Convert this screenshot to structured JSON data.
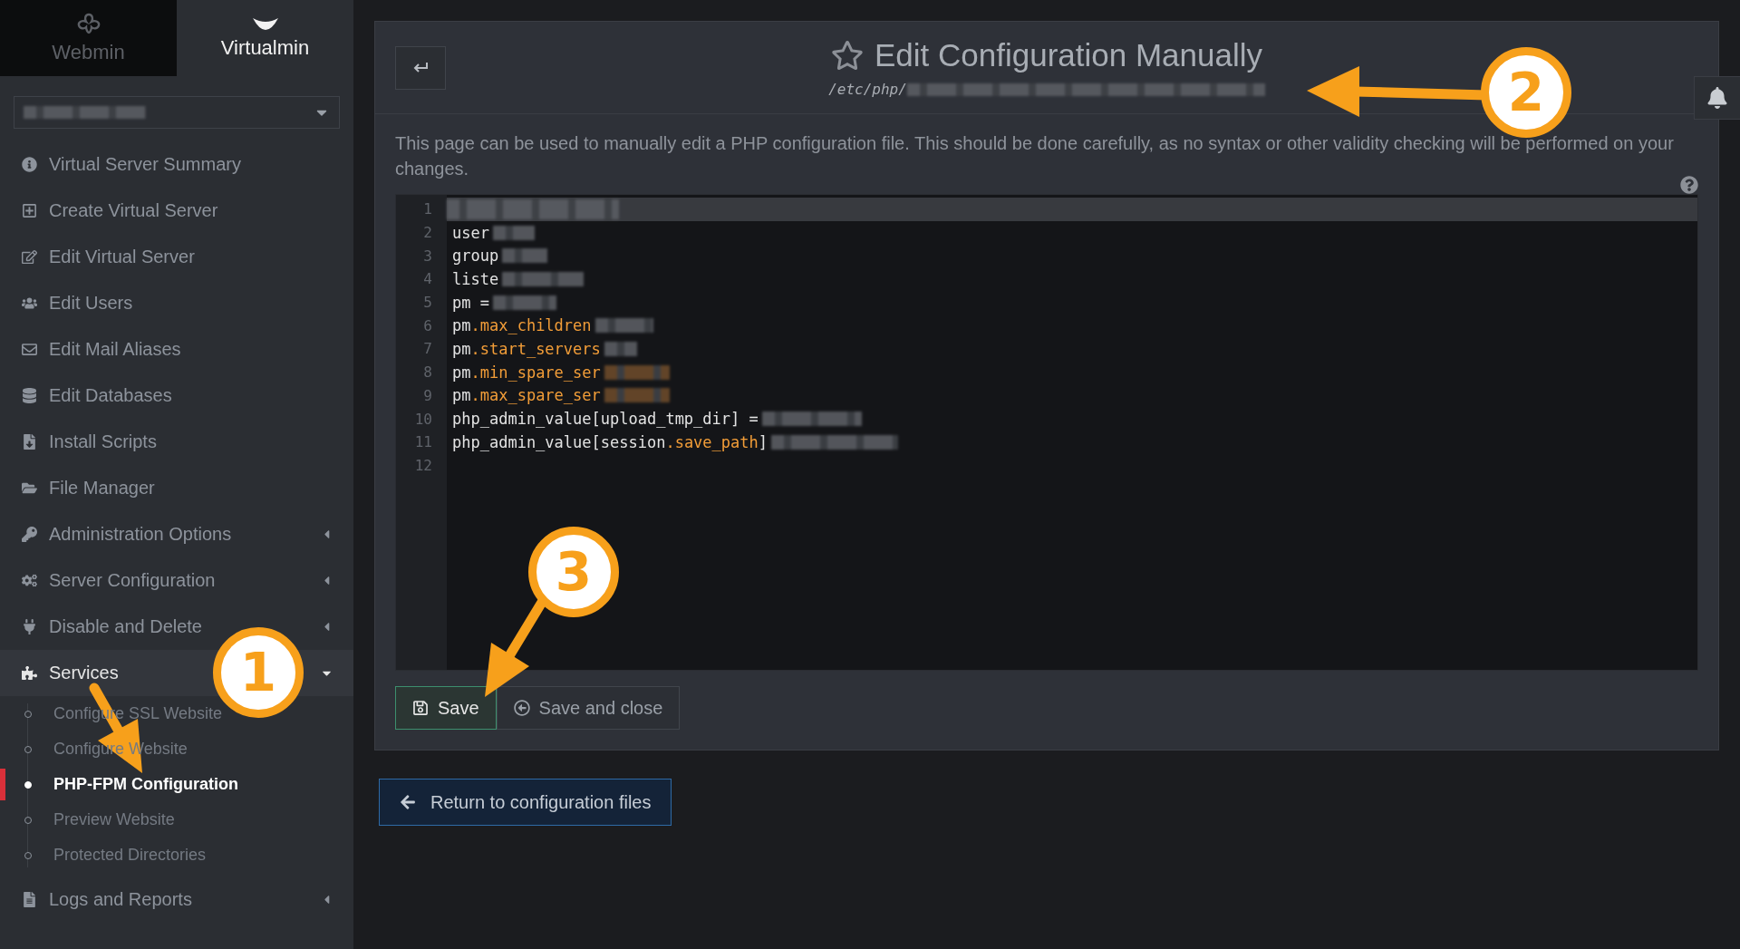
{
  "top_tabs": [
    {
      "label": "Webmin",
      "selected": false
    },
    {
      "label": "Virtualmin",
      "selected": true
    }
  ],
  "server_select": {
    "masked": true
  },
  "menu": [
    {
      "label": "Virtual Server Summary",
      "has_submenu": false,
      "expanded": false
    },
    {
      "label": "Create Virtual Server",
      "has_submenu": false,
      "expanded": false
    },
    {
      "label": "Edit Virtual Server",
      "has_submenu": false,
      "expanded": false
    },
    {
      "label": "Edit Users",
      "has_submenu": false,
      "expanded": false
    },
    {
      "label": "Edit Mail Aliases",
      "has_submenu": false,
      "expanded": false
    },
    {
      "label": "Edit Databases",
      "has_submenu": false,
      "expanded": false
    },
    {
      "label": "Install Scripts",
      "has_submenu": false,
      "expanded": false
    },
    {
      "label": "File Manager",
      "has_submenu": false,
      "expanded": false
    },
    {
      "label": "Administration Options",
      "has_submenu": true,
      "expanded": false
    },
    {
      "label": "Server Configuration",
      "has_submenu": true,
      "expanded": false
    },
    {
      "label": "Disable and Delete",
      "has_submenu": true,
      "expanded": false
    },
    {
      "label": "Services",
      "has_submenu": true,
      "expanded": true,
      "children": [
        {
          "label": "Configure SSL Website",
          "selected": false
        },
        {
          "label": "Configure Website",
          "selected": false
        },
        {
          "label": "PHP-FPM Configuration",
          "selected": true
        },
        {
          "label": "Preview Website",
          "selected": false
        },
        {
          "label": "Protected Directories",
          "selected": false
        }
      ]
    },
    {
      "label": "Logs and Reports",
      "has_submenu": true,
      "expanded": false
    }
  ],
  "page": {
    "title": "Edit Configuration Manually",
    "path": "/etc/php/",
    "path_masked": true,
    "description": "This page can be used to manually edit a PHP configuration file. This should be done carefully, as no syntax or other validity checking will be performed on your changes."
  },
  "editor": {
    "lines": [
      {
        "number": "1",
        "active": true,
        "masked": true
      },
      {
        "number": "2",
        "active": false,
        "masked": true,
        "segments": [
          {
            "kind": "plain",
            "text": "user"
          }
        ]
      },
      {
        "number": "3",
        "active": false,
        "masked": true,
        "segments": [
          {
            "kind": "plain",
            "text": "group"
          }
        ]
      },
      {
        "number": "4",
        "active": false,
        "masked": true,
        "segments": [
          {
            "kind": "plain",
            "text": "liste"
          }
        ]
      },
      {
        "number": "5",
        "active": false,
        "masked": true,
        "segments": [
          {
            "kind": "plain",
            "text": "pm ="
          }
        ]
      },
      {
        "number": "6",
        "active": false,
        "masked": true,
        "segments": [
          {
            "kind": "plain",
            "text": "pm"
          },
          {
            "kind": "key",
            "text": ".max_children"
          }
        ]
      },
      {
        "number": "7",
        "active": false,
        "masked": true,
        "segments": [
          {
            "kind": "plain",
            "text": "pm"
          },
          {
            "kind": "key",
            "text": ".start_servers"
          }
        ]
      },
      {
        "number": "8",
        "active": false,
        "masked": true,
        "segments": [
          {
            "kind": "plain",
            "text": "pm"
          },
          {
            "kind": "key",
            "text": ".min_spare_ser"
          }
        ]
      },
      {
        "number": "9",
        "active": false,
        "masked": true,
        "segments": [
          {
            "kind": "plain",
            "text": "pm"
          },
          {
            "kind": "key",
            "text": ".max_spare_ser"
          }
        ]
      },
      {
        "number": "10",
        "active": false,
        "masked": true,
        "segments": [
          {
            "kind": "plain",
            "text": "php_admin_value[upload_tmp_dir] ="
          }
        ]
      },
      {
        "number": "11",
        "active": false,
        "masked": true,
        "segments": [
          {
            "kind": "plain",
            "text": "php_admin_value[session"
          },
          {
            "kind": "key",
            "text": ".save_path"
          },
          {
            "kind": "plain",
            "text": "]"
          }
        ]
      },
      {
        "number": "12",
        "active": false,
        "masked": false
      }
    ]
  },
  "form_buttons": [
    {
      "label": "Save",
      "kind": "primary"
    },
    {
      "label": "Save and close",
      "kind": "default"
    }
  ],
  "return_button": {
    "label": "Return to configuration files"
  },
  "annotations": [
    {
      "number": "1"
    },
    {
      "number": "2"
    },
    {
      "number": "3"
    }
  ]
}
